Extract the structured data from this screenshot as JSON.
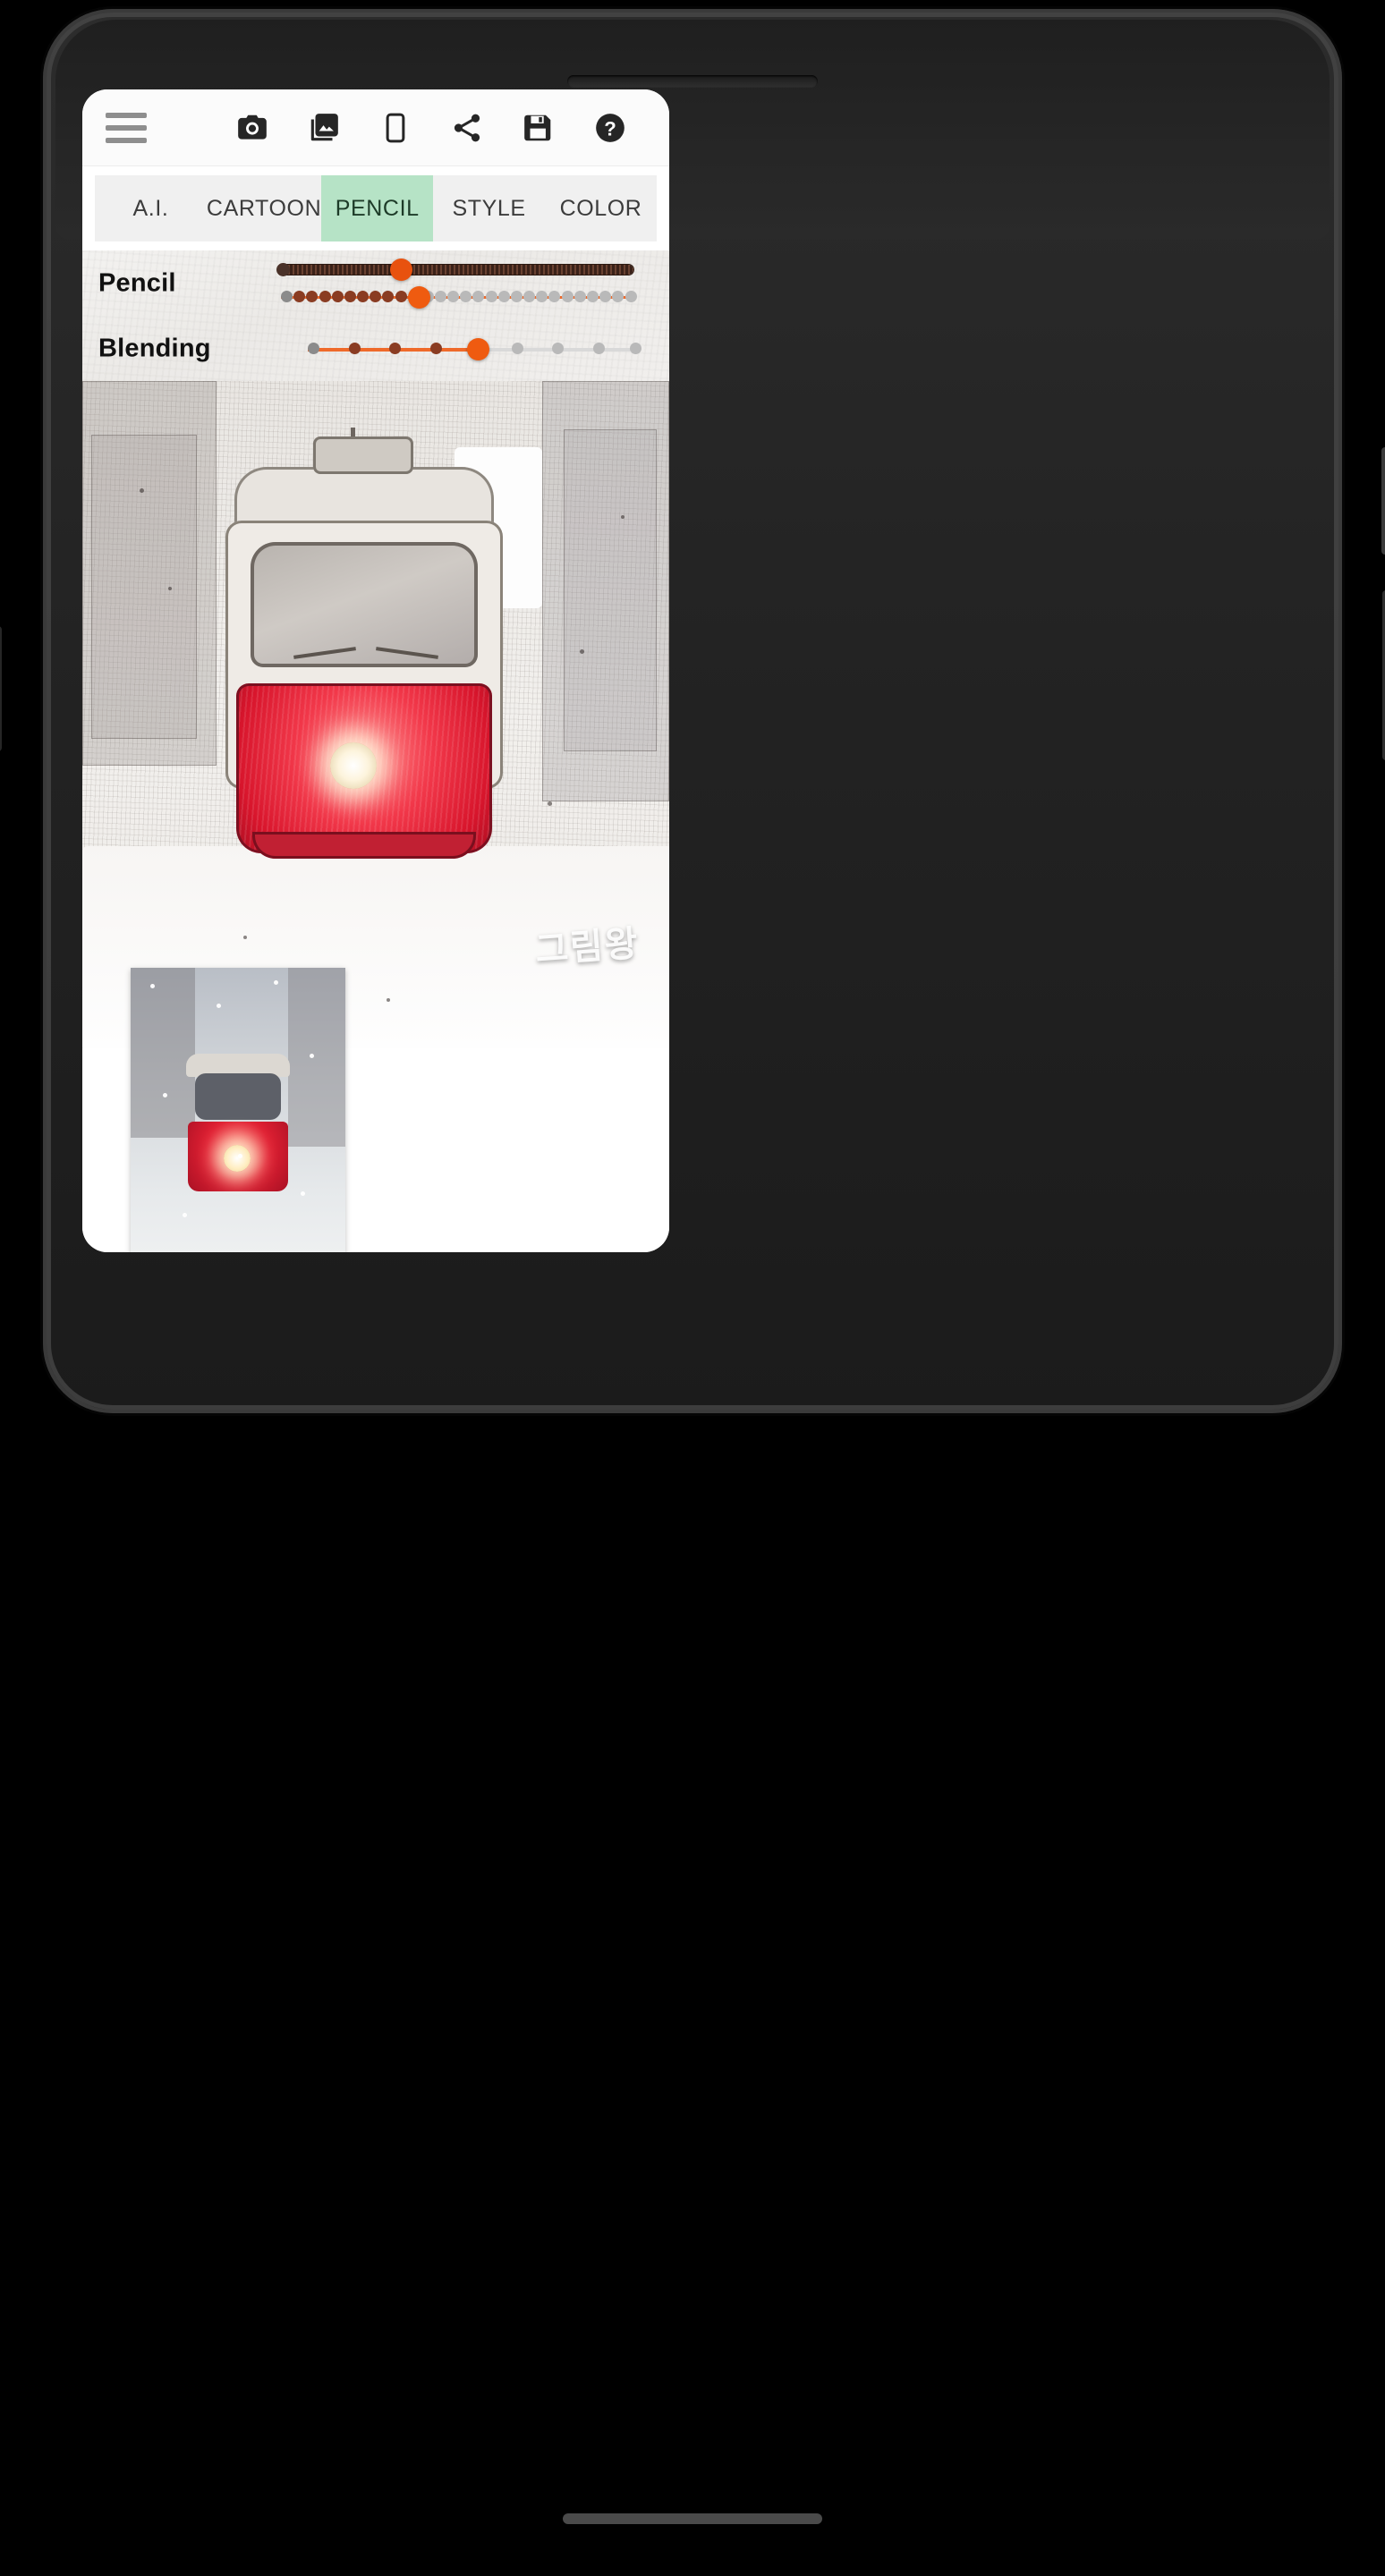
{
  "device": {
    "name": "android-phone",
    "front_camera": "front-camera-lens",
    "earpiece": "earpiece-speaker"
  },
  "app": {
    "toolbar": {
      "menu_label": "menu",
      "icons": [
        {
          "name": "camera-icon",
          "label": "Camera"
        },
        {
          "name": "gallery-icon",
          "label": "Gallery"
        },
        {
          "name": "frame-icon",
          "label": "Frame"
        },
        {
          "name": "share-icon",
          "label": "Share"
        },
        {
          "name": "save-icon",
          "label": "Save"
        },
        {
          "name": "help-icon",
          "label": "Help"
        }
      ]
    },
    "tabs": [
      {
        "label": "A.I.",
        "selected": false
      },
      {
        "label": "CARTOON",
        "selected": false
      },
      {
        "label": "PENCIL",
        "selected": true
      },
      {
        "label": "STYLE",
        "selected": false
      },
      {
        "label": "COLOR",
        "selected": false
      }
    ],
    "sliders": [
      {
        "label": "Pencil",
        "tracks": [
          {
            "kind": "solid-dark",
            "value_pct": 31,
            "color": "#4a3229",
            "thumb_color": "#e8520f"
          },
          {
            "kind": "dotted",
            "value_pct": 37,
            "color": "#ef6a2a",
            "thumb_color": "#ef5b10"
          }
        ]
      },
      {
        "label": "Blending",
        "tracks": [
          {
            "kind": "dotted",
            "value_pct": 50,
            "color": "#ef6a2a",
            "thumb_color": "#ef5b10"
          }
        ]
      }
    ],
    "canvas": {
      "name": "pencil-sketch-preview",
      "watermark": "그림왕",
      "subject": "red tram on snowy street"
    },
    "thumbnail": {
      "name": "original-photo-thumbnail",
      "subject": "red tram on snowy street"
    }
  },
  "colors": {
    "accent_green": "#b6e3c6",
    "slider_orange": "#ef6a2a",
    "slider_dark": "#4a3229",
    "tab_bg": "#f0f0f0",
    "appbar_bg": "#fbfbfb"
  }
}
